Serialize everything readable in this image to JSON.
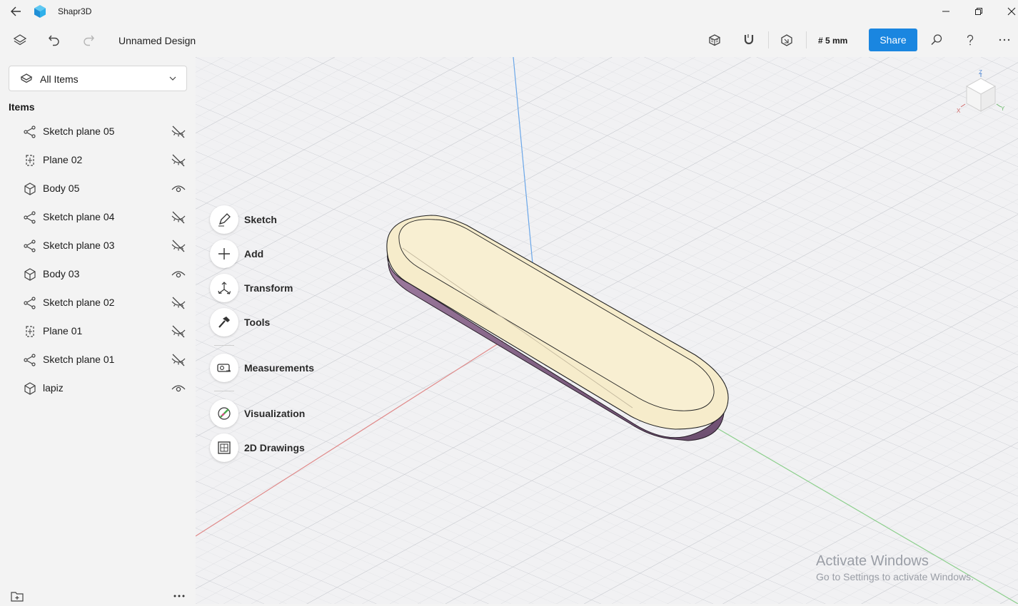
{
  "titlebar": {
    "app_title": "Shapr3D",
    "icons": [
      "back-arrow-icon",
      "shapr3d-logo-icon",
      "minimize-icon",
      "restore-icon",
      "close-icon"
    ]
  },
  "toolbar": {
    "document_title": "Unnamed Design",
    "grid_readout": "# 5 mm",
    "share_label": "Share",
    "accent_color": "#1a86e0",
    "icons": [
      "layers-icon",
      "undo-icon",
      "redo-icon",
      "view-style-icon",
      "snap-magnet-icon",
      "selection-filter-icon",
      "search-icon",
      "help-icon",
      "more-icon"
    ]
  },
  "sidebar": {
    "filter_label": "All Items",
    "items_heading": "Items",
    "items": [
      {
        "label": "Sketch plane 05",
        "type": "sketch",
        "visible": false
      },
      {
        "label": "Plane 02",
        "type": "plane",
        "visible": false
      },
      {
        "label": "Body 05",
        "type": "body",
        "visible": true
      },
      {
        "label": "Sketch plane 04",
        "type": "sketch",
        "visible": false
      },
      {
        "label": "Sketch plane 03",
        "type": "sketch",
        "visible": false
      },
      {
        "label": "Body 03",
        "type": "body",
        "visible": true
      },
      {
        "label": "Sketch plane 02",
        "type": "sketch",
        "visible": false
      },
      {
        "label": "Plane 01",
        "type": "plane",
        "visible": false
      },
      {
        "label": "Sketch plane 01",
        "type": "sketch",
        "visible": false
      },
      {
        "label": "lapiz",
        "type": "body",
        "visible": true
      }
    ]
  },
  "tools": [
    {
      "label": "Sketch",
      "icon": "pen-icon"
    },
    {
      "label": "Add",
      "icon": "plus-icon"
    },
    {
      "label": "Transform",
      "icon": "transform-icon"
    },
    {
      "label": "Tools",
      "icon": "hammer-icon"
    },
    {
      "label": "Measurements",
      "icon": "tape-measure-icon"
    },
    {
      "label": "Visualization",
      "icon": "palette-icon"
    },
    {
      "label": "2D Drawings",
      "icon": "drawing-icon"
    }
  ],
  "view_cube": {
    "axis_labels": [
      "Z",
      "X",
      "Y"
    ]
  },
  "watermark": {
    "line1": "Activate Windows",
    "line2": "Go to Settings to activate Windows."
  }
}
